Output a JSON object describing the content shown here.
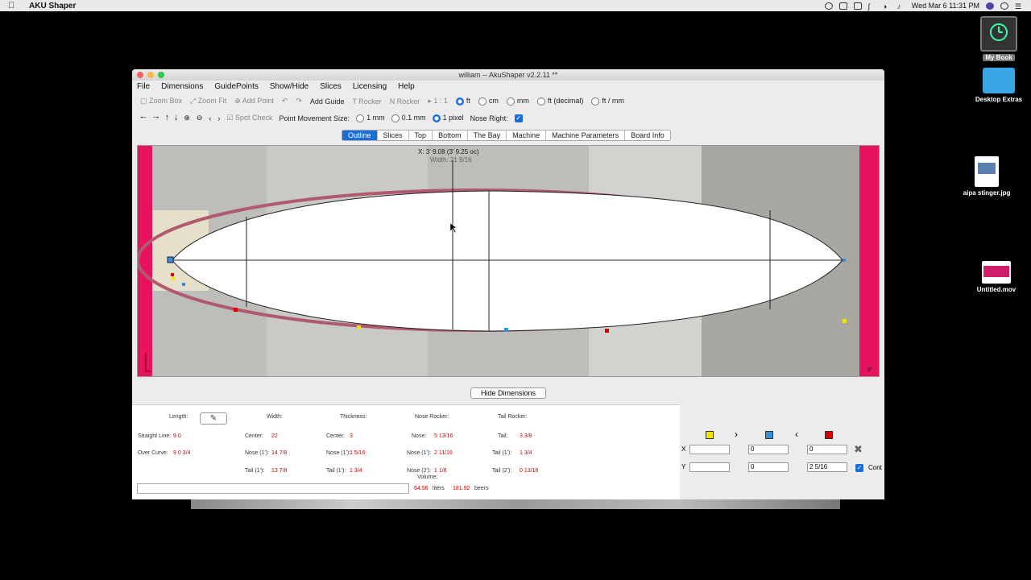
{
  "menubar": {
    "app_name": "AKU Shaper",
    "clock": "Wed Mar 6  11:31 PM"
  },
  "desktop": {
    "items": [
      {
        "label": "My Book"
      },
      {
        "label": "Desktop Extras"
      },
      {
        "label": "aipa stinger.jpg"
      },
      {
        "label": "Untitled.mov"
      }
    ]
  },
  "window": {
    "title": "william -- AkuShaper v2.2.11  **",
    "menus": [
      "File",
      "Dimensions",
      "GuidePoints",
      "Show/Hide",
      "Slices",
      "Licensing",
      "Help"
    ],
    "toolbar1": {
      "zoom_box": "Zoom Box",
      "zoom_fit": "Zoom Fit",
      "add_point": "Add Point",
      "add_guide": "Add Guide",
      "t_rocker": "T Rocker",
      "n_rocker": "N Rocker",
      "scale": "1 : 1",
      "units": [
        {
          "label": "ft",
          "selected": true
        },
        {
          "label": "cm",
          "selected": false
        },
        {
          "label": "mm",
          "selected": false
        },
        {
          "label": "ft (decimal)",
          "selected": false
        },
        {
          "label": "ft / mm",
          "selected": false
        }
      ]
    },
    "toolbar2": {
      "spot_check": "Spot Check",
      "point_movement_label": "Point Movement Size:",
      "sizes": [
        {
          "label": "1 mm",
          "selected": false
        },
        {
          "label": "0.1 mm",
          "selected": false
        },
        {
          "label": "1 pixel",
          "selected": true
        }
      ],
      "nose_right_label": "Nose Right:",
      "nose_right_checked": true
    },
    "tabs": [
      {
        "label": "Outline",
        "active": true
      },
      {
        "label": "Slices",
        "active": false
      },
      {
        "label": "Top",
        "active": false
      },
      {
        "label": "Bottom",
        "active": false
      },
      {
        "label": "The Bay",
        "active": false
      },
      {
        "label": "Machine",
        "active": false
      },
      {
        "label": "Machine Parameters",
        "active": false
      },
      {
        "label": "Board Info",
        "active": false
      }
    ],
    "canvas": {
      "cursor_readout": "X: 3' 9.08 (3' 9.25 oc)",
      "width_readout": "Width: 21 9/16",
      "corner_label": "8\""
    },
    "hide_dimensions_button": "Hide Dimensions",
    "dimensions": {
      "length_label": "Length:",
      "width_label": "Width:",
      "thickness_label": "Thickness:",
      "nose_rocker_label": "Nose Rocker:",
      "tail_rocker_label": "Tail Rocker:",
      "straight_line_label": "Straight Line:",
      "straight_line_value": "9  0",
      "over_curve_label": "Over Curve:",
      "over_curve_value": "9  0 3/4",
      "width_center_label": "Center:",
      "width_center_value": "22",
      "width_nose_label": "Nose (1'):",
      "width_nose_value": "14 7/8",
      "width_tail_label": "Tail (1'):",
      "width_tail_value": "13 7/8",
      "thick_center_label": "Center:",
      "thick_center_value": "3",
      "thick_nose_label": "Nose (1'):",
      "thick_nose_value": "1 5/16",
      "thick_tail_label": "Tail (1'):",
      "thick_tail_value": "1 3/4",
      "nr_nose_label": "Nose:",
      "nr_nose_value": "5 13/16",
      "nr_nose1_label": "Nose (1'):",
      "nr_nose1_value": "2 11/16",
      "nr_nose2_label": "Nose (2'):",
      "nr_nose2_value": "1 1/8",
      "tr_tail_label": "Tail:",
      "tr_tail_value": "3 3/8",
      "tr_tail1_label": "Tail (1'):",
      "tr_tail1_value": "1 3/4",
      "tr_tail2_label": "Tail (2'):",
      "tr_tail2_value": "0 13/16",
      "volume_label": "Volume:",
      "volume_liters": "64.56",
      "liters_label": "liters",
      "volume_beers": "181.92",
      "beers_label": "beers"
    },
    "point_editor": {
      "x_label": "X",
      "y_label": "Y",
      "x_values": [
        "",
        "0",
        "0"
      ],
      "y_values": [
        "",
        "0",
        "2 5/16"
      ],
      "cont_label": "Cont",
      "cont_checked": true
    }
  },
  "colors": {
    "accent": "#1a6ed8",
    "dimension_value": "#cc0000",
    "guide_magenta": "#e8125f",
    "outline_pink": "#b05a70",
    "yellow_point": "#f2e600",
    "blue_point": "#3a8ed6",
    "red_point": "#e00000"
  }
}
